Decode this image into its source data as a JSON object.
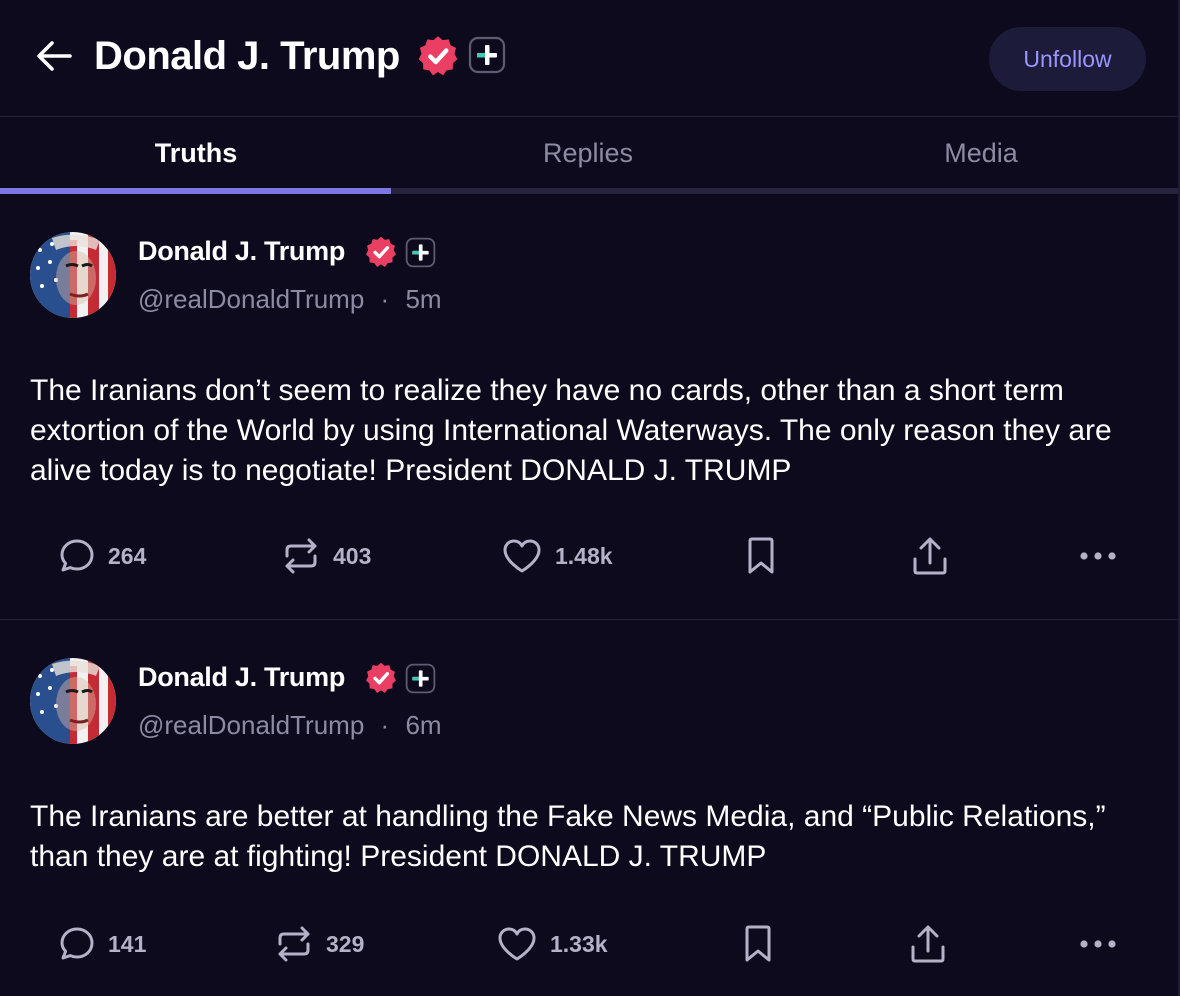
{
  "header": {
    "title": "Donald J. Trump",
    "unfollow_label": "Unfollow"
  },
  "tabs": [
    {
      "label": "Truths",
      "active": true
    },
    {
      "label": "Replies",
      "active": false
    },
    {
      "label": "Media",
      "active": false
    }
  ],
  "colors": {
    "background": "#0c0a1c",
    "accent": "#7c77e4",
    "verified_badge": "#ea3f63",
    "muted_text": "#8d8aa3"
  },
  "icons": [
    "back-arrow-icon",
    "verified-badge-icon",
    "plus-badge-icon",
    "comment-icon",
    "retruth-icon",
    "heart-icon",
    "bookmark-icon",
    "share-icon",
    "more-icon"
  ],
  "posts": [
    {
      "author": "Donald J. Trump",
      "handle": "@realDonaldTrump",
      "separator": "·",
      "time": "5m",
      "text": "The Iranians don’t seem to realize they have no cards, other than a short term extortion of the World by using International Waterways. The only reason they are alive today is to negotiate! President DONALD J. TRUMP",
      "replies": "264",
      "retruths": "403",
      "likes": "1.48k"
    },
    {
      "author": "Donald J. Trump",
      "handle": "@realDonaldTrump",
      "separator": "·",
      "time": "6m",
      "text": "The Iranians are better at handling the Fake News Media, and “Public Relations,” than they are at fighting! President DONALD J. TRUMP",
      "replies": "141",
      "retruths": "329",
      "likes": "1.33k"
    }
  ]
}
